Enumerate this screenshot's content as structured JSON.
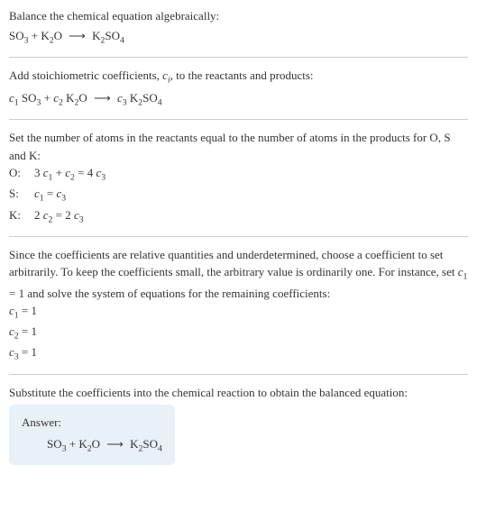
{
  "section1": {
    "intro": "Balance the chemical equation algebraically:",
    "eq_lhs1": "SO",
    "eq_sub1": "3",
    "eq_plus1": " + K",
    "eq_sub2": "2",
    "eq_o": "O",
    "eq_arrow": "⟶",
    "eq_rhs": "K",
    "eq_sub3": "2",
    "eq_so": "SO",
    "eq_sub4": "4"
  },
  "section2": {
    "intro_a": "Add stoichiometric coefficients, ",
    "intro_ci": "c",
    "intro_i": "i",
    "intro_b": ", to the reactants and products:",
    "c1": "c",
    "c1sub": "1",
    "so3": " SO",
    "so3sub": "3",
    "plus": " + ",
    "c2": "c",
    "c2sub": "2",
    "k2o": " K",
    "k2osub1": "2",
    "k2o_o": "O",
    "arrow": "⟶",
    "c3": "c",
    "c3sub": "3",
    "k2so4": " K",
    "k2so4sub1": "2",
    "k2so4_so": "SO",
    "k2so4sub2": "4"
  },
  "section3": {
    "intro": "Set the number of atoms in the reactants equal to the number of atoms in the products for O, S and K:",
    "o_label": "O:",
    "o_eq_a": "3 ",
    "o_c1": "c",
    "o_c1sub": "1",
    "o_plus": " + ",
    "o_c2": "c",
    "o_c2sub": "2",
    "o_eq": " = 4 ",
    "o_c3": "c",
    "o_c3sub": "3",
    "s_label": "S:",
    "s_c1": "c",
    "s_c1sub": "1",
    "s_eq": " = ",
    "s_c3": "c",
    "s_c3sub": "3",
    "k_label": "K:",
    "k_a": "2 ",
    "k_c2": "c",
    "k_c2sub": "2",
    "k_eq": " = 2 ",
    "k_c3": "c",
    "k_c3sub": "3"
  },
  "section4": {
    "intro_a": "Since the coefficients are relative quantities and underdetermined, choose a coefficient to set arbitrarily. To keep the coefficients small, the arbitrary value is ordinarily one. For instance, set ",
    "intro_c1": "c",
    "intro_c1sub": "1",
    "intro_b": " = 1 and solve the system of equations for the remaining coefficients:",
    "r1_c": "c",
    "r1_sub": "1",
    "r1_val": " = 1",
    "r2_c": "c",
    "r2_sub": "2",
    "r2_val": " = 1",
    "r3_c": "c",
    "r3_sub": "3",
    "r3_val": " = 1"
  },
  "section5": {
    "intro": "Substitute the coefficients into the chemical reaction to obtain the balanced equation:",
    "answer_label": "Answer:",
    "so3": "SO",
    "so3sub": "3",
    "plus": " + K",
    "k2osub": "2",
    "o": "O",
    "arrow": "⟶",
    "k2": "K",
    "k2sub": "2",
    "so4": "SO",
    "so4sub": "4"
  }
}
